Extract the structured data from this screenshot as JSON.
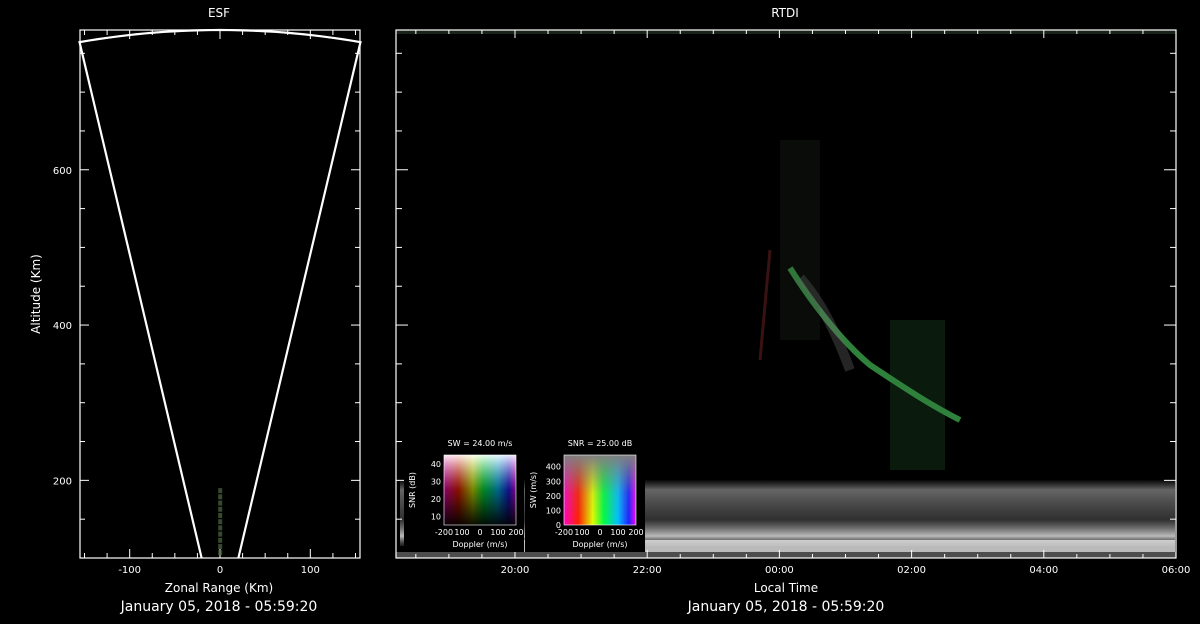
{
  "esf": {
    "title": "ESF",
    "xlabel": "Zonal Range (Km)",
    "ylabel": "Altitude (Km)",
    "timestamp": "January 05, 2018 - 05:59:20"
  },
  "rtdi": {
    "title": "RTDI",
    "xlabel": "Local Time",
    "timestamp": "January 05, 2018 - 05:59:20"
  },
  "colorbar_sw": {
    "title": "SW = 24.00 m/s",
    "xlabel": "Doppler (m/s)",
    "ylabel": "SNR (dB)"
  },
  "colorbar_snr": {
    "title": "SNR = 25.00 dB",
    "xlabel": "Doppler (m/s)",
    "ylabel": "SW (m/s)"
  },
  "colors": {
    "axis": "#ffffff",
    "background": "#000000",
    "echo_green": "#3fae4f",
    "echo_white": "#d8d8d8"
  },
  "chart_data": [
    {
      "id": "esf",
      "type": "scatter",
      "title": "ESF",
      "xlabel": "Zonal Range (Km)",
      "ylabel": "Altitude (Km)",
      "xlim": [
        -155,
        155
      ],
      "ylim": [
        100,
        780
      ],
      "xticks": [
        -100,
        0,
        100
      ],
      "yticks": [
        200,
        400,
        600
      ],
      "xtick_labels": [
        "-100",
        "0",
        "100"
      ],
      "ytick_labels": [
        "200",
        "400",
        "600"
      ],
      "beam_half_angle_deg": 11.5,
      "beam_max_range_km": 780,
      "echo_altitude_range_km": [
        110,
        190
      ],
      "grid": false
    },
    {
      "id": "rtdi",
      "type": "heatmap",
      "title": "RTDI",
      "xlabel": "Local Time",
      "ylabel": "",
      "xlim": [
        18.2,
        30.0
      ],
      "ylim": [
        100,
        780
      ],
      "xtick_positions": [
        20,
        22,
        24,
        26,
        28,
        30
      ],
      "xtick_labels": [
        "20:00",
        "22:00",
        "00:00",
        "02:00",
        "04:00",
        "06:00"
      ],
      "ytick_values": [
        200,
        400,
        600
      ],
      "bottom_echo_band_km": [
        100,
        190
      ],
      "plume_echo_path": [
        [
          24.2,
          450
        ],
        [
          24.8,
          380
        ],
        [
          25.5,
          320
        ],
        [
          26.3,
          280
        ]
      ],
      "grid": false
    },
    {
      "id": "colorbar_sw",
      "type": "heatmap",
      "title": "SW = 24.00 m/s",
      "xlabel": "Doppler (m/s)",
      "ylabel": "SNR (dB)",
      "xlim": [
        -200,
        200
      ],
      "ylim": [
        5,
        45
      ],
      "xtick_values": [
        -200,
        -100,
        0,
        100,
        200
      ],
      "xtick_labels": [
        "-200",
        "100",
        "0",
        "100",
        "200"
      ],
      "yticks": [
        10,
        20,
        30,
        40
      ],
      "ytick_labels": [
        "10",
        "20",
        "30",
        "40"
      ]
    },
    {
      "id": "colorbar_snr",
      "type": "heatmap",
      "title": "SNR = 25.00 dB",
      "xlabel": "Doppler (m/s)",
      "ylabel": "SW (m/s)",
      "xlim": [
        -200,
        200
      ],
      "ylim": [
        0,
        480
      ],
      "xtick_values": [
        -200,
        -100,
        0,
        100,
        200
      ],
      "xtick_labels": [
        "-200",
        "100",
        "0",
        "100",
        "200"
      ],
      "yticks": [
        0,
        100,
        200,
        300,
        400
      ],
      "ytick_labels": [
        "0",
        "100",
        "200",
        "300",
        "400"
      ]
    }
  ]
}
